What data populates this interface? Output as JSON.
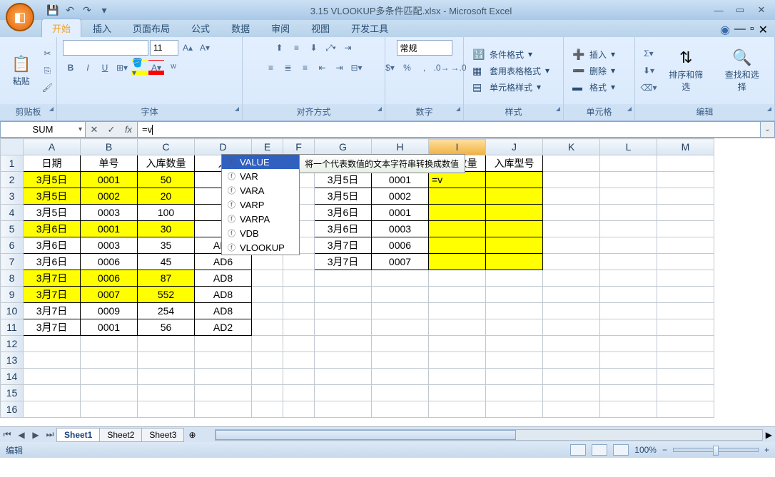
{
  "title": "3.15 VLOOKUP多条件匹配.xlsx - Microsoft Excel",
  "tabs": [
    "开始",
    "插入",
    "页面布局",
    "公式",
    "数据",
    "审阅",
    "视图",
    "开发工具"
  ],
  "activeTab": 0,
  "ribbon": {
    "clipboard": {
      "label": "剪贴板",
      "paste": "粘贴"
    },
    "font": {
      "label": "字体",
      "size": "11",
      "b": "B",
      "i": "I",
      "u": "U"
    },
    "align": {
      "label": "对齐方式"
    },
    "number": {
      "label": "数字",
      "general": "常规",
      "percent": "%",
      "comma": ","
    },
    "styles": {
      "label": "样式",
      "cond": "条件格式",
      "table": "套用表格格式",
      "cell": "单元格样式"
    },
    "cells": {
      "label": "单元格",
      "insert": "插入",
      "delete": "删除",
      "format": "格式"
    },
    "editing": {
      "label": "编辑",
      "sort": "排序和筛选",
      "find": "查找和选择"
    }
  },
  "formulaBar": {
    "nameBox": "SUM",
    "formula": "=v"
  },
  "columns": [
    "A",
    "B",
    "C",
    "D",
    "E",
    "F",
    "G",
    "H",
    "I",
    "J",
    "K",
    "L",
    "M"
  ],
  "activeCol": "I",
  "rowCount": 16,
  "leftHeaders": {
    "A": "日期",
    "B": "单号",
    "C": "入库数量",
    "D": "入"
  },
  "rightHeaders": {
    "G": "日期",
    "H": "单号",
    "I": "入库数量",
    "J": "入库型号"
  },
  "leftData": [
    {
      "r": 2,
      "A": "3月5日",
      "B": "0001",
      "C": "50",
      "D": "",
      "y": true
    },
    {
      "r": 3,
      "A": "3月5日",
      "B": "0002",
      "C": "20",
      "D": "",
      "y": true
    },
    {
      "r": 4,
      "A": "3月5日",
      "B": "0003",
      "C": "100",
      "D": "",
      "y": false
    },
    {
      "r": 5,
      "A": "3月6日",
      "B": "0001",
      "C": "30",
      "D": "",
      "y": true
    },
    {
      "r": 6,
      "A": "3月6日",
      "B": "0003",
      "C": "35",
      "D": "AD6",
      "y": false
    },
    {
      "r": 7,
      "A": "3月6日",
      "B": "0006",
      "C": "45",
      "D": "AD6",
      "y": false
    },
    {
      "r": 8,
      "A": "3月7日",
      "B": "0006",
      "C": "87",
      "D": "AD8",
      "y": true
    },
    {
      "r": 9,
      "A": "3月7日",
      "B": "0007",
      "C": "552",
      "D": "AD8",
      "y": true
    },
    {
      "r": 10,
      "A": "3月7日",
      "B": "0009",
      "C": "254",
      "D": "AD8",
      "y": false
    },
    {
      "r": 11,
      "A": "3月7日",
      "B": "0001",
      "C": "56",
      "D": "AD2",
      "y": false
    }
  ],
  "rightData": [
    {
      "r": 2,
      "G": "3月5日",
      "H": "0001",
      "I": "=v"
    },
    {
      "r": 3,
      "G": "3月5日",
      "H": "0002"
    },
    {
      "r": 4,
      "G": "3月6日",
      "H": "0001"
    },
    {
      "r": 5,
      "G": "3月6日",
      "H": "0003"
    },
    {
      "r": 6,
      "G": "3月7日",
      "H": "0006"
    },
    {
      "r": 7,
      "G": "3月7日",
      "H": "0007"
    }
  ],
  "autocomplete": {
    "items": [
      "VALUE",
      "VAR",
      "VARA",
      "VARP",
      "VARPA",
      "VDB",
      "VLOOKUP"
    ],
    "selected": 0,
    "tooltip": "将一个代表数值的文本字符串转换成数值"
  },
  "sheets": [
    "Sheet1",
    "Sheet2",
    "Sheet3"
  ],
  "activeSheet": 0,
  "status": {
    "mode": "编辑",
    "zoom": "100%"
  }
}
